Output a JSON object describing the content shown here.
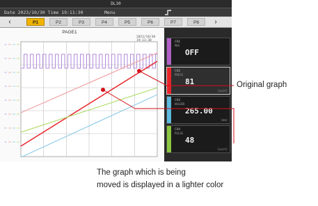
{
  "device": {
    "model": "DL30",
    "datetime": "Date 2023/10/30 Time 19:11:30",
    "menu_label": "Menu"
  },
  "tabs": {
    "left_arrow": "‹",
    "right_arrow": "›",
    "items": [
      {
        "label": "P1",
        "active": true
      },
      {
        "label": "P2",
        "active": false
      },
      {
        "label": "P3",
        "active": false
      },
      {
        "label": "P4",
        "active": false
      },
      {
        "label": "P5",
        "active": false
      },
      {
        "label": "P6",
        "active": false
      },
      {
        "label": "P7",
        "active": false
      },
      {
        "label": "P8",
        "active": false
      }
    ]
  },
  "plot": {
    "page_title": "PAGE1",
    "timestamp": "2023/10/30 19:11:30",
    "colors": {
      "pulse": "#b08ad8",
      "original_red": "#e8242a",
      "ghost_red": "#f2a0a4",
      "blue": "#8fcde8",
      "green": "#b6dd72",
      "grid": "#bfbfbf"
    }
  },
  "channels": [
    {
      "name": "CH1",
      "tag": "MOS",
      "value": "OFF",
      "unit": "",
      "color": "#b15fc7"
    },
    {
      "name": "CH2",
      "tag": "PRESS",
      "value": "81",
      "unit": "[unit]",
      "color": "#e8242a"
    },
    {
      "name": "CH3",
      "tag": "HOLDER",
      "value": "265.00",
      "unit": "[mm]",
      "color": "#5dbadf"
    },
    {
      "name": "CH4",
      "tag": "PULSE",
      "value": "48",
      "unit": "[unit]",
      "color": "#8cc63f"
    }
  ],
  "annotations": {
    "original": "Original graph",
    "moved_line1": "The graph which is being",
    "moved_line2": "moved is displayed in a lighter color"
  }
}
